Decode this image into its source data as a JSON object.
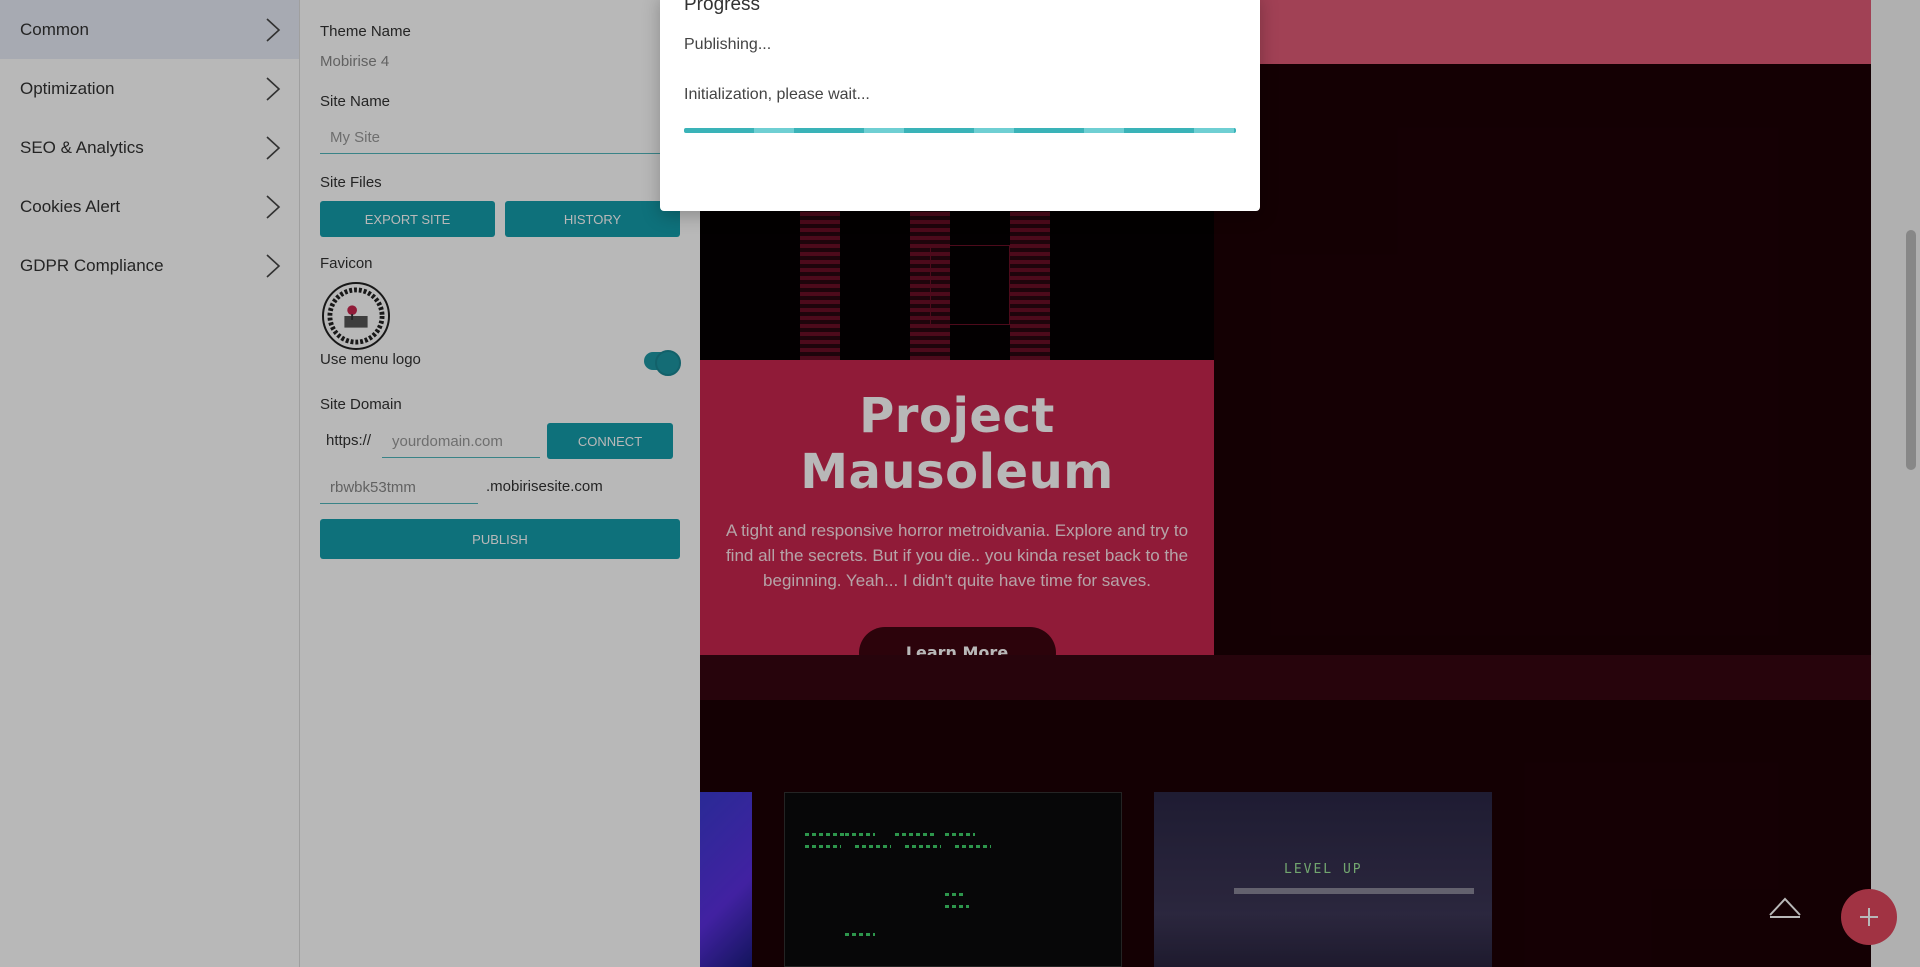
{
  "nav": {
    "items": [
      {
        "label": "Common",
        "active": true
      },
      {
        "label": "Optimization",
        "active": false
      },
      {
        "label": "SEO & Analytics",
        "active": false
      },
      {
        "label": "Cookies Alert",
        "active": false
      },
      {
        "label": "GDPR Compliance",
        "active": false
      }
    ]
  },
  "settings": {
    "theme_name_label": "Theme Name",
    "theme_name_value": "Mobirise 4",
    "site_name_label": "Site Name",
    "site_name_placeholder": "My Site",
    "site_files_label": "Site Files",
    "export_site_button": "EXPORT SITE",
    "history_button": "HISTORY",
    "favicon_label": "Favicon",
    "use_menu_logo_label": "Use menu logo",
    "use_menu_logo_on": true,
    "site_domain_label": "Site Domain",
    "domain_prefix": "https://",
    "domain_placeholder": "yourdomain.com",
    "connect_button": "CONNECT",
    "subdomain_value": "rbwbk53tmm",
    "subdomain_suffix": ".mobirisesite.com",
    "publish_button": "PUBLISH"
  },
  "dialog": {
    "title": "Progress",
    "status": "Publishing...",
    "substatus": "Initialization, please wait..."
  },
  "preview": {
    "card_title": "Project Mausoleum",
    "card_description": "A tight and responsive horror metroidvania. Explore and try to find all the secrets. But if you die.. you kinda reset back to the beginning. Yeah... I didn't quite have time for saves.",
    "learn_more_button": "Learn More",
    "thumb3_text": "LEVEL UP"
  },
  "colors": {
    "accent": "#149dab",
    "preview_card": "#c8264e",
    "preview_topbar": "#e05a76",
    "fab": "#e0475e"
  }
}
